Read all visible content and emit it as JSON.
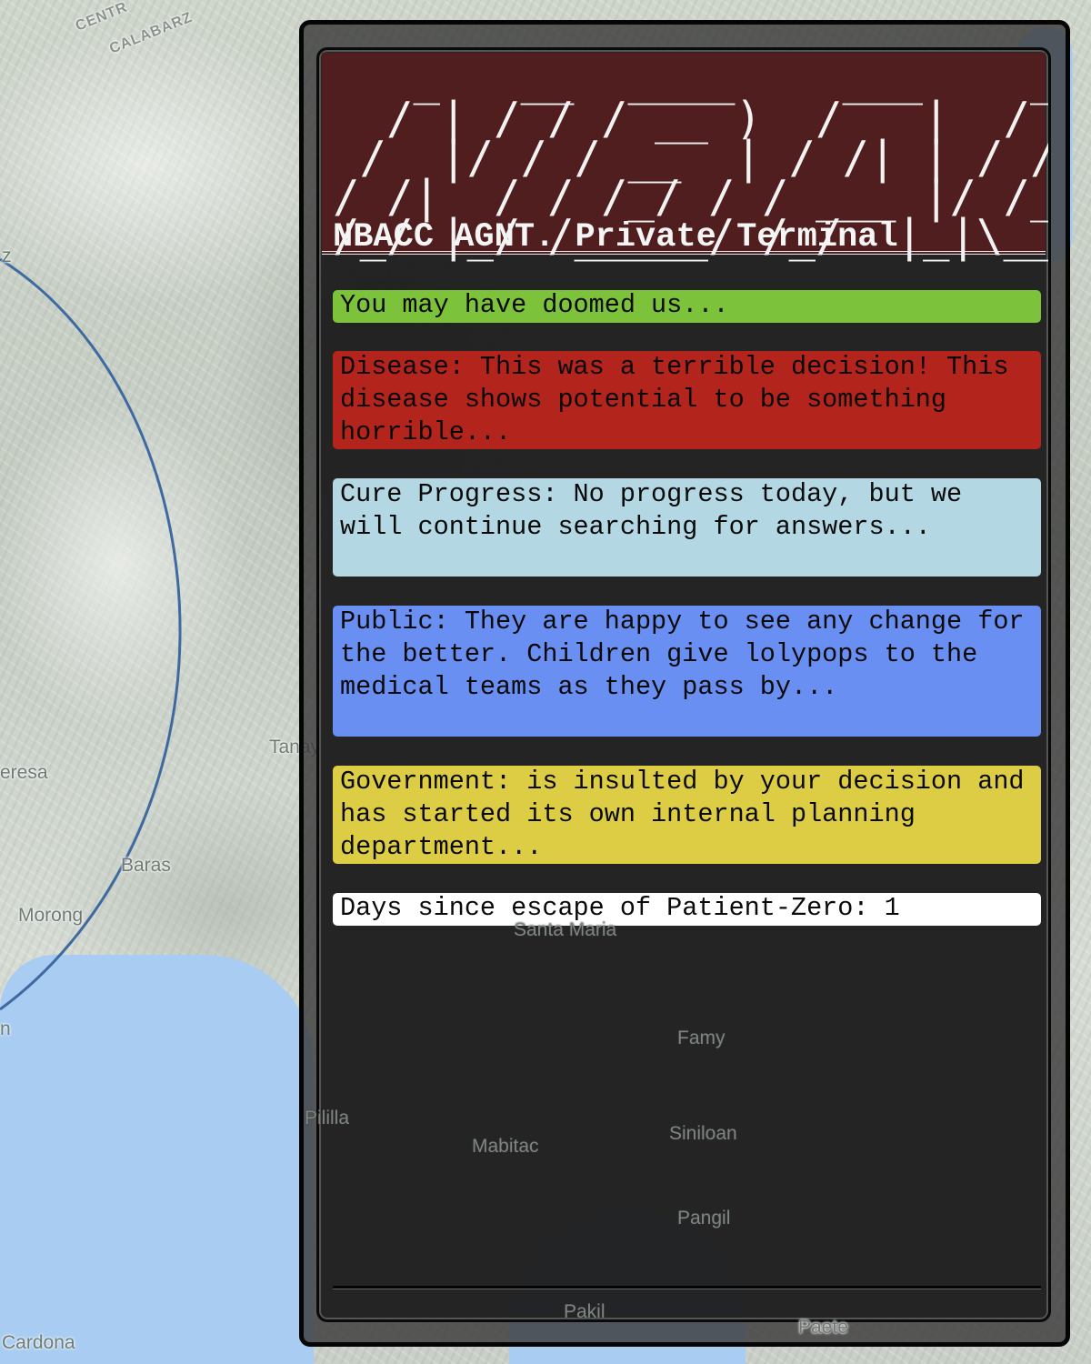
{
  "map": {
    "labels": {
      "region_1": "CENTR",
      "region_2": "CALABARZ",
      "edge_z": "z",
      "teresa": "eresa",
      "tanay": "Tanay",
      "baras": "Baras",
      "morong": "Morong",
      "edge_n": "n",
      "santa_maria": "Santa Maria",
      "famy": "Famy",
      "pililla": "Pililla",
      "mabitac": "Mabitac",
      "siniloan": "Siniloan",
      "pangil": "Pangil",
      "pakil": "Pakil",
      "paete": "Paete",
      "cardona": "Cardona"
    },
    "colors": {
      "water": "#a9cdf2",
      "ring": "#3f6aa0"
    }
  },
  "terminal": {
    "ascii_logo": "   _   __  ____    ___    ______ ______\n  / | / / / __ )  /   |  / ____// ____/\n /  |/ / / __  | / /| | / /    / /     \n/ /|  / / /_/ / / ___ |/ /___ / /___   \n/_/ |_/ /_____/ /_/  |_|\\____/ \\____/ ",
    "title": "NBACC AGNT. Private Terminal",
    "messages": {
      "overall": "You may have doomed us...",
      "disease": "Disease: This was a terrible decision! This disease shows potential to be something horrible...",
      "cure": "Cure Progress: No progress today, but we will continue searching for answers...",
      "public": "Public: They are happy to see any change for the better. Children give lolypops to the medical teams as they pass by...",
      "government": "Government: is insulted by your decision and has started its own internal planning department...",
      "days": "Days since escape of Patient-Zero: 1"
    },
    "colors": {
      "header_bg": "#551e1e",
      "overall": "#7cc23b",
      "disease": "#b3241c",
      "cure": "#b3d8e4",
      "public": "#6a8ff2",
      "government": "#dccd45",
      "days": "#ffffff"
    }
  }
}
